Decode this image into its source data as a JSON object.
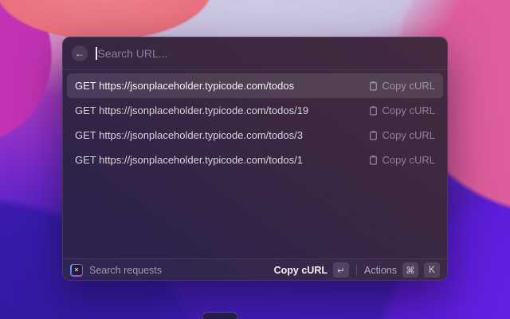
{
  "window": {
    "search": {
      "placeholder": "Search URL...",
      "back_label": "←"
    },
    "list": [
      {
        "title": "GET https://jsonplaceholder.typicode.com/todos",
        "accessory": "Copy cURL",
        "selected": true
      },
      {
        "title": "GET https://jsonplaceholder.typicode.com/todos/19",
        "accessory": "Copy cURL",
        "selected": false
      },
      {
        "title": "GET https://jsonplaceholder.typicode.com/todos/3",
        "accessory": "Copy cURL",
        "selected": false
      },
      {
        "title": "GET https://jsonplaceholder.typicode.com/todos/1",
        "accessory": "Copy cURL",
        "selected": false
      }
    ],
    "footer": {
      "left_label": "Search requests",
      "primary_action": "Copy cURL",
      "primary_key": "↵",
      "secondary_action": "Actions",
      "secondary_key_1": "⌘",
      "secondary_key_2": "K",
      "app_icon_glyph": "✕"
    }
  },
  "colors": {
    "selection_bg": "rgba(255,255,255,0.11)",
    "panel_top": "#432b41",
    "panel_bottom": "#2c2150",
    "wallpaper_pink": "#dd5c9c",
    "wallpaper_magenta": "#c233b4",
    "wallpaper_violet": "#5a22c4",
    "wallpaper_lavender": "#cac4e0"
  }
}
